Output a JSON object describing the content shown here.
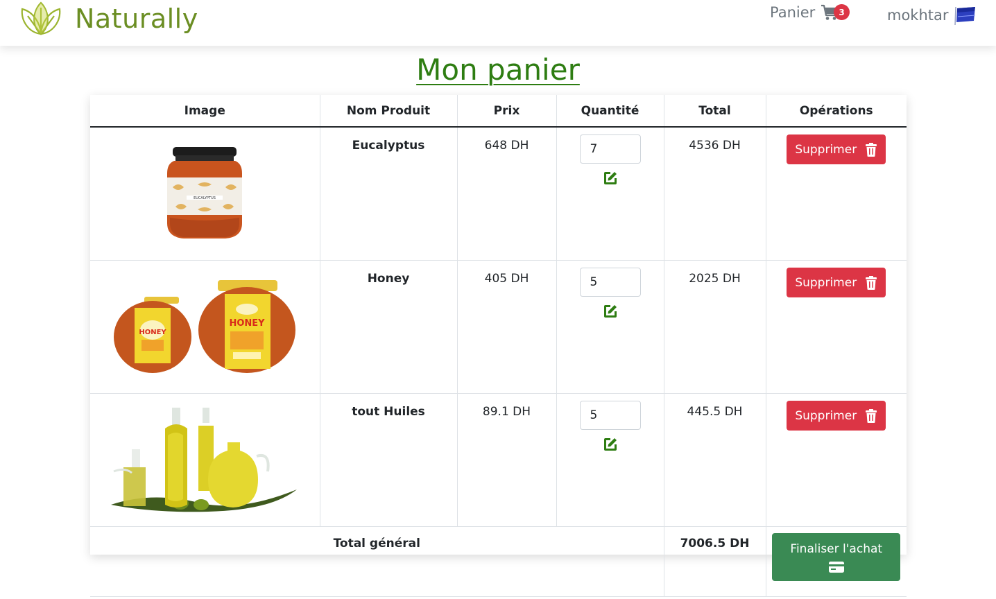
{
  "header": {
    "brand_name": "Naturally",
    "cart_label": "Panier",
    "cart_count": "3",
    "user_name": "mokhtar"
  },
  "page": {
    "title": "Mon panier"
  },
  "table": {
    "columns": [
      "Image",
      "Nom Produit",
      "Prix",
      "Quantité",
      "Total",
      "Opérations"
    ],
    "rows": [
      {
        "image": "eucalyptus-honey-jar-image",
        "name": "Eucalyptus",
        "price": "648 DH",
        "quantity": "7",
        "total": "4536 DH",
        "delete_label": "Supprimer"
      },
      {
        "image": "honey-jars-image",
        "name": "Honey",
        "price": "405 DH",
        "quantity": "5",
        "total": "2025 DH",
        "delete_label": "Supprimer"
      },
      {
        "image": "olive-oil-bottles-image",
        "name": "tout Huiles",
        "price": "89.1 DH",
        "quantity": "5",
        "total": "445.5 DH",
        "delete_label": "Supprimer"
      }
    ],
    "footer": {
      "label": "Total général",
      "grand_total": "7006.5 DH",
      "checkout_label": "Finaliser l'achat"
    }
  },
  "colors": {
    "brand": "#6b8e23",
    "title": "#2e7d12",
    "delete": "#dc3545",
    "checkout": "#3a8a54",
    "edit_icon": "#2e7d12",
    "badge": "#dc3545"
  },
  "icons": [
    "leaf-logo-icon",
    "cart-icon",
    "flag-icon",
    "edit-icon",
    "trash-icon",
    "credit-card-icon"
  ]
}
